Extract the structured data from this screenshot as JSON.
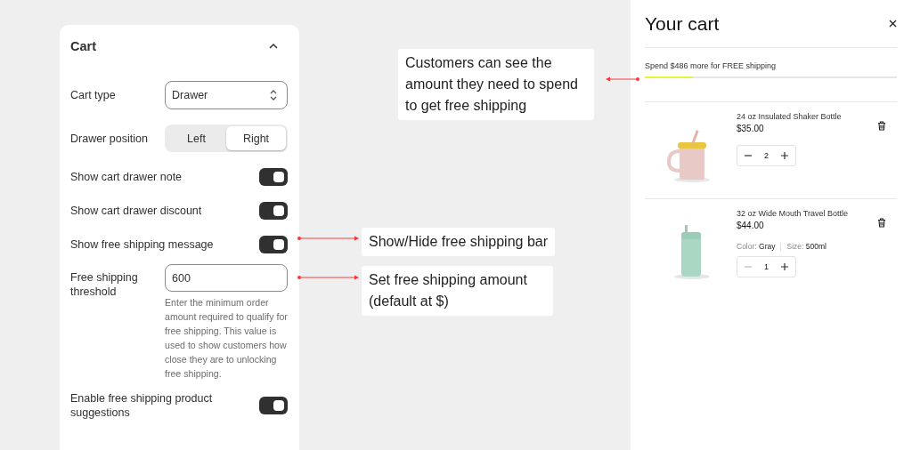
{
  "settings": {
    "title": "Cart",
    "expanded": true,
    "rows": [
      {
        "kind": "select",
        "label": "Cart type",
        "value": "Drawer"
      },
      {
        "kind": "segmented",
        "label": "Drawer position",
        "options": [
          {
            "label": "Left",
            "selected": false
          },
          {
            "label": "Right",
            "selected": true
          }
        ]
      },
      {
        "kind": "toggle",
        "label": "Show cart drawer note",
        "on": true
      },
      {
        "kind": "toggle",
        "label": "Show cart drawer discount",
        "on": true
      },
      {
        "kind": "toggle",
        "label": "Show free shipping message",
        "on": true
      },
      {
        "kind": "input",
        "label": "Free shipping threshold",
        "value": "600",
        "help": "Enter the minimum order amount required to qualify for free shipping. This value is used to show customers how close they are to unlocking free shipping."
      },
      {
        "kind": "toggle",
        "label": "Enable free shipping product suggestions",
        "on": true
      }
    ]
  },
  "annotations": [
    {
      "text": "Customers can see the amount they need to spend to get free shipping"
    },
    {
      "text": "Show/Hide free shipping bar"
    },
    {
      "text": "Set free shipping amount (default at $)"
    }
  ],
  "cart": {
    "title": "Your cart",
    "shipping_message": "Spend $486 more for FREE shipping",
    "level": 0.19,
    "items": [
      {
        "name": "24 oz Insulated Shaker Bottle",
        "price": "$35.00",
        "quantity": "2",
        "minus_disabled": false
      },
      {
        "name": "32 oz Wide Mouth Travel Bottle",
        "price": "$44.00",
        "variant": [
          {
            "label": "Color:",
            "value": "Gray"
          },
          {
            "label": "Size:",
            "value": "500ml"
          }
        ],
        "quantity": "1",
        "minus_disabled": true
      }
    ]
  }
}
